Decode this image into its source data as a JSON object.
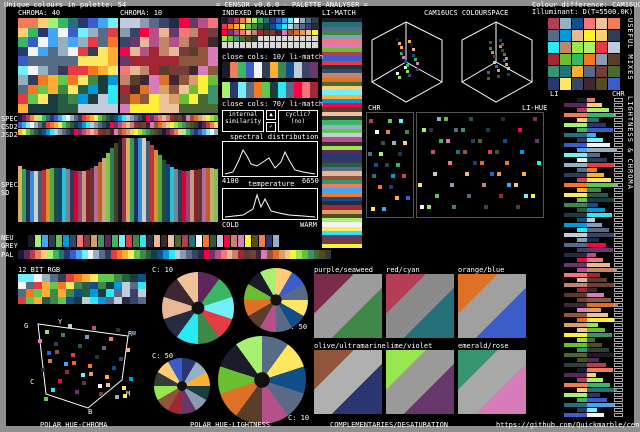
{
  "header": {
    "unique_colours": "Unique colours in palette: 54",
    "title": "= CENSOR v0.6.0 - PALETTE ANALYSER =",
    "colour_difference": "Colour difference: CAM16UCS",
    "illuminant": "Illuminant: D(T=5500.0K)"
  },
  "labels": {
    "chroma40": "CHROMA: 40",
    "chroma10": "CHROMA: 10",
    "indexed_palette": "INDEXED PALETTE",
    "li_match": "LI-MATCH",
    "cam16": "CAM16UCS COLOURSPACE",
    "spec": "SPEC",
    "csd2": "CSD2",
    "jsd2": "JSD2",
    "spec_sd": "SPEC",
    "sd": "SD",
    "neu": "NEU",
    "grey": "GREY",
    "pal": "PAL",
    "close_cols_1": "close cols: 10/ li-match",
    "close_cols_2": "close cols: 70/ li-match",
    "internal_similarity": "internal similarity",
    "cyclic": "cyclic?",
    "no": "(no)",
    "spectral": "spectral distribution",
    "spec_min": "4100",
    "spec_max": "6650",
    "temperature": "temperature",
    "cold": "COLD",
    "warm": "WARM",
    "chr": "CHR",
    "li_hue": "LI-HUE",
    "li": "LI",
    "chr2": "CHR",
    "useful_mixes": "USEFUL MIXES",
    "lightness_chroma": "LIGHTNESS & CHROMA",
    "rgb12": "12 BIT RGB",
    "c10a": "C: 10",
    "c50a": "C: 50",
    "c50b": "C: 50",
    "c10b": "C: 10",
    "purple_seaweed": "purple/seaweed",
    "red_cyan": "red/cyan",
    "orange_blue": "orange/blue",
    "olive_ultramarine": "olive/ultramarine",
    "lime_violet": "lime/violet",
    "emerald_rose": "emerald/rose",
    "polar_hue_chroma": "POLAR HUE-CHROMA",
    "polar_hue_lightness": "POLAR HUE-LIGHTNESS",
    "complementaries": "COMPLEMENTARIES/DESATURATION",
    "url": "https://github.com/Quickmarble/censor",
    "hue_letters": [
      "G",
      "Y",
      "R",
      "C",
      "B",
      "M"
    ],
    "check": "✓",
    "arrow": "▲"
  },
  "colors": {
    "frame": "#8f8f8f",
    "palette": [
      "#1a1c2c",
      "#5d275d",
      "#b13e53",
      "#ef7d57",
      "#ffcd75",
      "#a7f070",
      "#38b764",
      "#257179",
      "#29366f",
      "#3b5dc9",
      "#41a6f6",
      "#73eff7",
      "#f4f4f4",
      "#94b0c2",
      "#566c86",
      "#333c57",
      "#e43b44",
      "#f77622",
      "#feae34",
      "#fee761",
      "#63c74d",
      "#3e8948",
      "#265c42",
      "#193c3e",
      "#124e89",
      "#0099db",
      "#2ce8f5",
      "#c0cbdc",
      "#8b9bb4",
      "#5a6988",
      "#3a4466",
      "#262b44",
      "#ff0044",
      "#68386c",
      "#b55088",
      "#f6757a",
      "#e8b796",
      "#c28569",
      "#a22633",
      "#5a3d2b",
      "#733e39",
      "#3e2731",
      "#d77bba",
      "#8f563b",
      "#df7126",
      "#d9a066",
      "#eec39a",
      "#fbf236",
      "#99e550",
      "#6abe30",
      "#37946e",
      "#4b692f",
      "#524b24",
      "#323c39"
    ]
  }
}
